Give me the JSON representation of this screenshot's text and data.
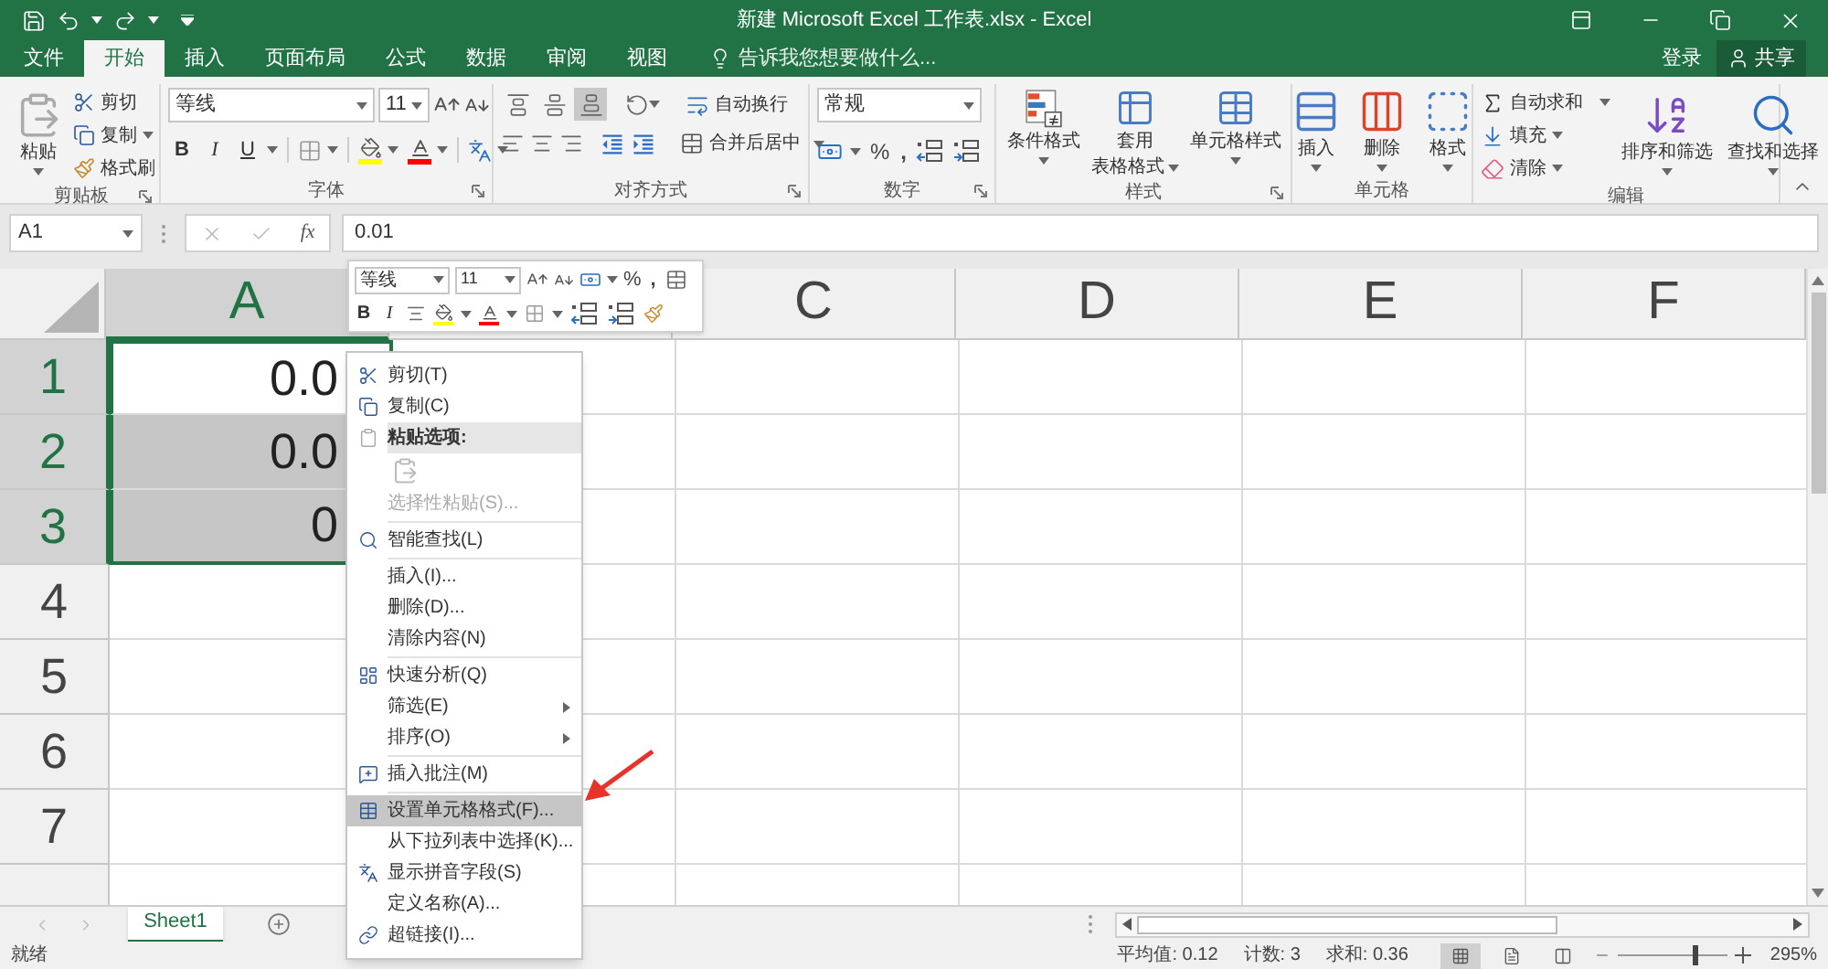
{
  "title_bar": {
    "title": "新建 Microsoft Excel 工作表.xlsx - Excel",
    "login": "登录",
    "share": "共享"
  },
  "ribbon_tabs": [
    {
      "label": "文件",
      "selected": false
    },
    {
      "label": "开始",
      "selected": true
    },
    {
      "label": "插入",
      "selected": false
    },
    {
      "label": "页面布局",
      "selected": false
    },
    {
      "label": "公式",
      "selected": false
    },
    {
      "label": "数据",
      "selected": false
    },
    {
      "label": "审阅",
      "selected": false
    },
    {
      "label": "视图",
      "selected": false
    }
  ],
  "tell_me": {
    "placeholder": "告诉我您想要做什么..."
  },
  "ribbon_groups": [
    {
      "kind": "clipboard",
      "label": "剪贴板",
      "paste": "粘贴",
      "cut": "剪切",
      "copy": "复制",
      "format_painter": "格式刷"
    },
    {
      "kind": "font",
      "label": "字体",
      "font_name": "等线",
      "font_size": "11",
      "bold": "B",
      "italic": "I",
      "underline": "U"
    },
    {
      "kind": "alignment",
      "label": "对齐方式",
      "wrap_text": "自动换行",
      "merge": "合并后居中",
      "vertical_align": [
        {
          "selected": false
        },
        {
          "selected": false
        },
        {
          "selected": true
        }
      ]
    },
    {
      "kind": "number",
      "label": "数字",
      "format": "常规",
      "percent": "%",
      "comma": ","
    },
    {
      "kind": "styles",
      "label": "样式",
      "buttons": [
        {
          "lines": [
            "条件格式"
          ]
        },
        {
          "lines": [
            "套用",
            "表格格式"
          ]
        },
        {
          "lines": [
            "单元格样式"
          ]
        }
      ]
    },
    {
      "kind": "cells",
      "label": "单元格",
      "buttons": [
        "插入",
        "删除",
        "格式"
      ]
    },
    {
      "kind": "editing",
      "label": "编辑",
      "autosum": "自动求和",
      "fill": "填充",
      "clear": "清除",
      "sort_filter": "排序和筛选",
      "find_select": "查找和选择"
    }
  ],
  "formula_bar": {
    "name_box": "A1",
    "fx": "fx",
    "value": "0.01"
  },
  "mini_toolbar": {
    "font_name": "等线",
    "font_size": "11",
    "percent": "%",
    "comma": ",",
    "bold": "B",
    "italic": "I"
  },
  "sheet": {
    "columns": [
      {
        "label": "A",
        "selected": true
      },
      {
        "selected": false
      },
      {
        "label": "C",
        "selected": false
      },
      {
        "label": "D",
        "selected": false
      },
      {
        "label": "E",
        "selected": false
      },
      {
        "label": "F",
        "selected": false
      }
    ],
    "rows": [
      {
        "label": "1",
        "selected": true,
        "cells": [
          {
            "value": "0.0",
            "selected": true,
            "active": true
          }
        ]
      },
      {
        "label": "2",
        "selected": true,
        "cells": [
          {
            "value": "0.0",
            "selected": true,
            "active": false
          }
        ]
      },
      {
        "label": "3",
        "selected": true,
        "cells": [
          {
            "value": "0",
            "selected": true,
            "active": false
          }
        ]
      },
      {
        "label": "4",
        "selected": false
      },
      {
        "label": "5",
        "selected": false
      },
      {
        "label": "6",
        "selected": false
      },
      {
        "label": "7",
        "selected": false
      },
      {
        "selected": false
      }
    ]
  },
  "context_menu": {
    "items": [
      {
        "kind": "item",
        "label": "剪切(T)",
        "selected": false,
        "disabled": false,
        "submenu": false
      },
      {
        "kind": "item",
        "label": "复制(C)",
        "selected": false,
        "disabled": false,
        "submenu": false
      },
      {
        "kind": "header",
        "label": "粘贴选项:"
      },
      {
        "kind": "paste-options"
      },
      {
        "kind": "item",
        "label": "选择性粘贴(S)...",
        "selected": false,
        "disabled": true,
        "submenu": false
      },
      {
        "kind": "separator"
      },
      {
        "kind": "item",
        "label": "智能查找(L)",
        "selected": false,
        "disabled": false,
        "submenu": false
      },
      {
        "kind": "separator"
      },
      {
        "kind": "item",
        "label": "插入(I)...",
        "selected": false,
        "disabled": false,
        "submenu": false
      },
      {
        "kind": "item",
        "label": "删除(D)...",
        "selected": false,
        "disabled": false,
        "submenu": false
      },
      {
        "kind": "item",
        "label": "清除内容(N)",
        "selected": false,
        "disabled": false,
        "submenu": false
      },
      {
        "kind": "separator"
      },
      {
        "kind": "item",
        "label": "快速分析(Q)",
        "selected": false,
        "disabled": false,
        "submenu": false
      },
      {
        "kind": "item",
        "label": "筛选(E)",
        "selected": false,
        "disabled": false,
        "submenu": true
      },
      {
        "kind": "item",
        "label": "排序(O)",
        "selected": false,
        "disabled": false,
        "submenu": true
      },
      {
        "kind": "separator"
      },
      {
        "kind": "item",
        "label": "插入批注(M)",
        "selected": false,
        "disabled": false,
        "submenu": false
      },
      {
        "kind": "separator"
      },
      {
        "kind": "item",
        "label": "设置单元格格式(F)...",
        "selected": true,
        "disabled": false,
        "submenu": false
      },
      {
        "kind": "item",
        "label": "从下拉列表中选择(K)...",
        "selected": false,
        "disabled": false,
        "submenu": false
      },
      {
        "kind": "item",
        "label": "显示拼音字段(S)",
        "selected": false,
        "disabled": false,
        "submenu": false
      },
      {
        "kind": "item",
        "label": "定义名称(A)...",
        "selected": false,
        "disabled": false,
        "submenu": false
      },
      {
        "kind": "item",
        "label": "超链接(I)...",
        "selected": false,
        "disabled": false,
        "submenu": false
      }
    ]
  },
  "sheet_tabs": [
    {
      "label": "Sheet1",
      "selected": true
    }
  ],
  "status_bar": {
    "status": "就绪",
    "average": "平均值: 0.12",
    "count": "计数: 3",
    "sum": "求和: 0.36",
    "views": [
      {
        "selected": true
      },
      {
        "selected": false
      },
      {
        "selected": false
      }
    ],
    "zoom": {
      "level": 0.72
    },
    "zoom_label": "295%"
  }
}
